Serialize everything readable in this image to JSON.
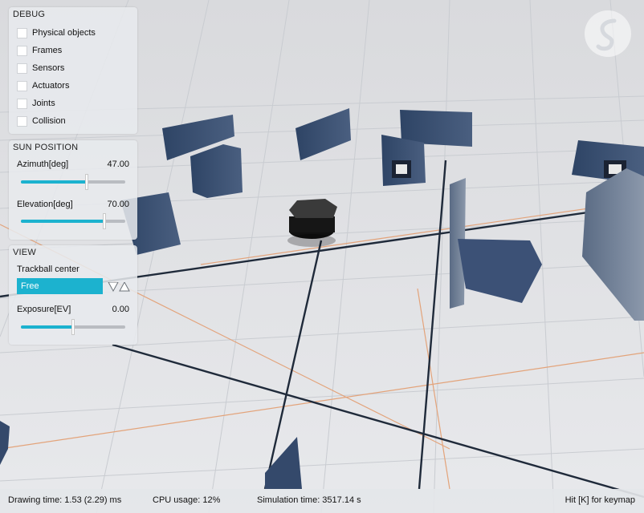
{
  "debug_panel": {
    "title": "DEBUG",
    "checkboxes": [
      {
        "label": "Physical objects",
        "checked": false
      },
      {
        "label": "Frames",
        "checked": false
      },
      {
        "label": "Sensors",
        "checked": false
      },
      {
        "label": "Actuators",
        "checked": false
      },
      {
        "label": "Joints",
        "checked": false
      },
      {
        "label": "Collision",
        "checked": false
      }
    ]
  },
  "sun_panel": {
    "title": "SUN POSITION",
    "azimuth": {
      "label": "Azimuth[deg]",
      "value_text": "47.00",
      "fill_fraction": 0.63
    },
    "elevation": {
      "label": "Elevation[deg]",
      "value_text": "70.00",
      "fill_fraction": 0.8
    }
  },
  "view_panel": {
    "title": "VIEW",
    "trackball_label": "Trackball center",
    "trackball_selected": "Free",
    "exposure": {
      "label": "Exposure[EV]",
      "value_text": "0.00",
      "fill_fraction": 0.5
    }
  },
  "status_bar": {
    "drawing_time": "Drawing time: 1.53 (2.29) ms",
    "cpu_usage": "CPU usage: 12%",
    "simulation_time": "Simulation time: 3517.14 s",
    "keymap_hint": "Hit [K] for keymap"
  },
  "colors": {
    "accent": "#1cb2cf",
    "floor": "#e6e7ea",
    "grid_fine": "#c7cbd0",
    "grid_major": "#1f2a3a",
    "grid_orange": "#e6a57a",
    "panel_blue": "#34496b"
  },
  "icons": {
    "logo": "s-logo-icon",
    "dropdown_down": "triangle-down-icon",
    "dropdown_up": "triangle-up-icon"
  }
}
